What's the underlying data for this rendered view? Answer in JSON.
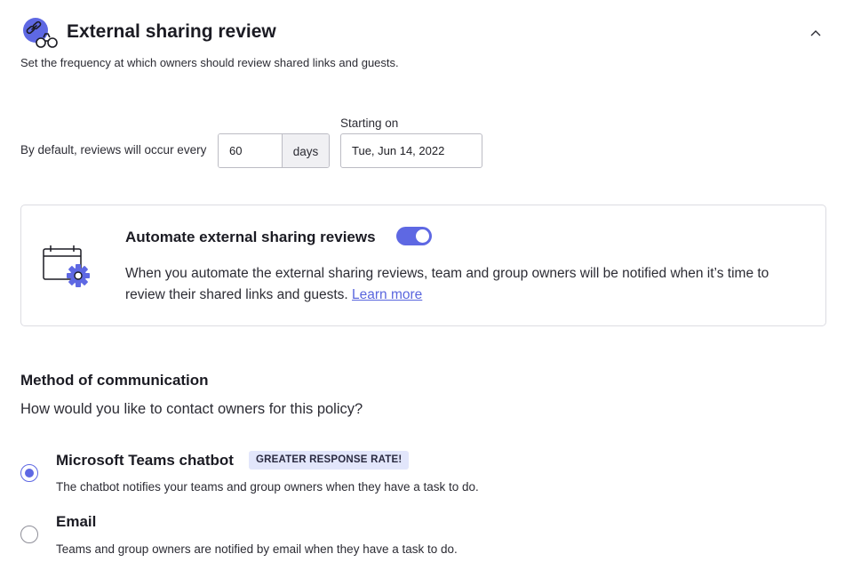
{
  "header": {
    "icon": "link-binoculars-icon",
    "title": "External sharing review",
    "subtitle": "Set the frequency at which owners should review shared links and guests.",
    "collapse_icon": "chevron-up-icon"
  },
  "frequency": {
    "label": "By default, reviews will occur every",
    "days_value": "60",
    "days_unit": "days",
    "start_label": "Starting on",
    "start_value": "Tue, Jun 14, 2022"
  },
  "automate": {
    "icon": "calendar-gear-icon",
    "title": "Automate external sharing reviews",
    "toggle_on": true,
    "description": "When you automate the external sharing reviews, team and group owners will be notified when it’s time to review their shared links and guests.",
    "learn_more": "Learn more"
  },
  "method": {
    "title": "Method of communication",
    "question": "How would you like to contact owners for this policy?",
    "options": [
      {
        "label": "Microsoft Teams chatbot",
        "badge": "GREATER RESPONSE RATE!",
        "description": "The chatbot notifies your teams and group owners when they have a task to do.",
        "selected": true
      },
      {
        "label": "Email",
        "description": "Teams and group owners are notified by email when they have a task to do.",
        "selected": false
      }
    ]
  },
  "colors": {
    "accent": "#5e68e3",
    "link": "#5a66de",
    "badge_bg": "#e2e6fb",
    "border": "#dcdce2"
  }
}
